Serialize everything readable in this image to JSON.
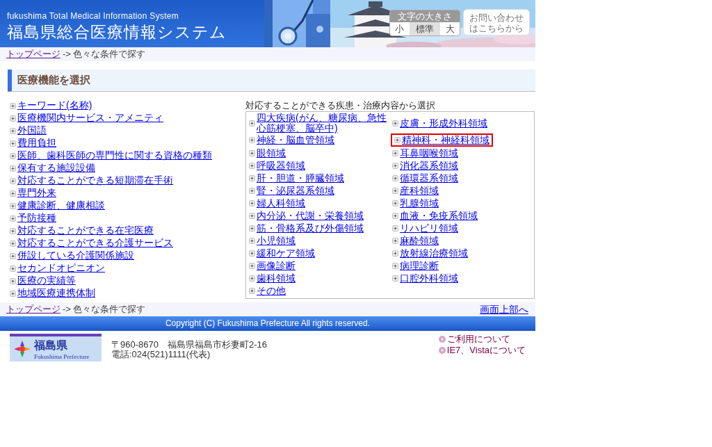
{
  "header": {
    "title_en": "fukushima Total Medical Information System",
    "title_ja": "福島県総合医療情報システム",
    "font_size": {
      "label": "文字の大きさ",
      "options": [
        {
          "label": "小",
          "selected": false
        },
        {
          "label": "標準",
          "selected": true
        },
        {
          "label": "大",
          "selected": false
        }
      ]
    },
    "contact_button": [
      "お問い合わせ",
      "はこちらから"
    ]
  },
  "breadcrumb": {
    "link": "トップページ",
    "separator": "->",
    "current": "色々な条件で探す"
  },
  "section_title": "医療機能を選択",
  "left_links": [
    "キーワード(名称)",
    "医療機関内サービス・アメニティ",
    "外国語",
    "費用負担",
    "医師、歯科医師の専門性に関する資格の種類",
    "保有する施設設備",
    "対応することができる短期滞在手術",
    "専門外来",
    "健康診断、健康相談",
    "予防接種",
    "対応することができる在宅医療",
    "対応することができる介護サービス",
    "併設している介護関係施設",
    "セカンドオピニオン",
    "医療の実績等",
    "地域医療連携体制"
  ],
  "disease_panel": {
    "caption": "対応することができる疾患・治療内容から選択",
    "columns": [
      [
        {
          "label": "四大疾病(がん、糖尿病、急性心筋梗塞、脳卒中)",
          "highlighted": false
        },
        {
          "label": "神経・脳血管領域",
          "highlighted": false
        },
        {
          "label": "眼領域",
          "highlighted": false
        },
        {
          "label": "呼吸器領域",
          "highlighted": false
        },
        {
          "label": "肝・胆道・膵臓領域",
          "highlighted": false
        },
        {
          "label": "腎・泌尿器系領域",
          "highlighted": false
        },
        {
          "label": "婦人科領域",
          "highlighted": false
        },
        {
          "label": "内分泌・代謝・栄養領域",
          "highlighted": false
        },
        {
          "label": "筋・骨格系及び外傷領域",
          "highlighted": false
        },
        {
          "label": "小児領域",
          "highlighted": false
        },
        {
          "label": "緩和ケア領域",
          "highlighted": false
        },
        {
          "label": "画像診断",
          "highlighted": false
        },
        {
          "label": "歯科領域",
          "highlighted": false
        },
        {
          "label": "その他",
          "highlighted": false
        }
      ],
      [
        {
          "label": "皮膚・形成外科領域",
          "highlighted": false
        },
        {
          "label": "精神科・神経科領域",
          "highlighted": true
        },
        {
          "label": "耳鼻咽喉領域",
          "highlighted": false
        },
        {
          "label": "消化器系領域",
          "highlighted": false
        },
        {
          "label": "循環器系領域",
          "highlighted": false
        },
        {
          "label": "産科領域",
          "highlighted": false
        },
        {
          "label": "乳腺領域",
          "highlighted": false
        },
        {
          "label": "血液・免疫系領域",
          "highlighted": false
        },
        {
          "label": "リハビリ領域",
          "highlighted": false
        },
        {
          "label": "麻酔領域",
          "highlighted": false
        },
        {
          "label": "放射線治療領域",
          "highlighted": false
        },
        {
          "label": "病理診断",
          "highlighted": false
        },
        {
          "label": "口腔外科領域",
          "highlighted": false
        }
      ]
    ]
  },
  "bottom_bar": {
    "link": "トップページ",
    "separator": "->",
    "current": "色々な条件で探す",
    "page_top": "画面上部へ"
  },
  "footer": {
    "copyright": "Copyright (C) Fukushima Prefecture All rights reserved.",
    "logo": {
      "name_ja": "福島県",
      "name_en": "Fukushima Prefecture"
    },
    "address": [
      "〒960-8670　福島県福島市杉妻町2-16",
      "電話:024(521)1111(代表)"
    ],
    "links": [
      "ご利用について",
      "IE7、Vistaについて"
    ]
  }
}
